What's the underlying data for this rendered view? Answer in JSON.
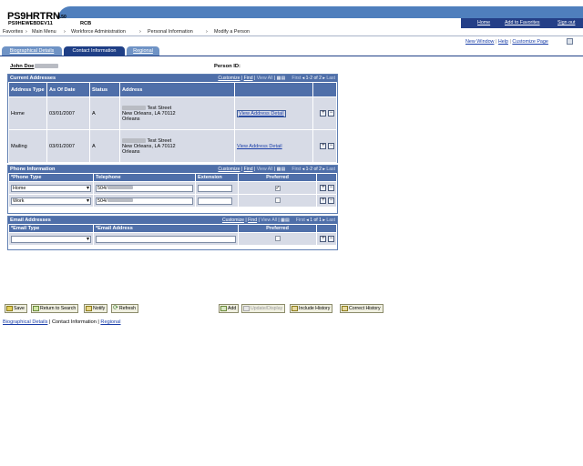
{
  "header": {
    "title": "PS9HRTRN",
    "version": "8.50",
    "subtitle": "PS9HEWEBDEV11",
    "rcb": "RCB",
    "links": [
      "Home",
      "Add to Favorites",
      "Sign out"
    ]
  },
  "breadcrumb": {
    "items": [
      "Favorites",
      "Main Menu",
      "Workforce Administration",
      "Personal Information",
      "Modify a Person"
    ]
  },
  "toplinks": {
    "new_window": "New Window",
    "help": "Help",
    "customize_page": "Customize Page"
  },
  "tabs": [
    {
      "label": "Biographical Details",
      "active": false
    },
    {
      "label": "Contact Information",
      "active": true
    },
    {
      "label": "Regional",
      "active": false
    }
  ],
  "person": {
    "name": "John Doe",
    "id_label": "Person ID:"
  },
  "grid_nav": {
    "customize": "Customize",
    "find": "Find",
    "view_all": "View All",
    "first": "First",
    "last": "Last"
  },
  "addresses": {
    "title": "Current Addresses",
    "range": "1-2 of 2",
    "headers": [
      "Address Type",
      "As Of Date",
      "Status",
      "Address"
    ],
    "detail_link": "View Address Detail",
    "rows": [
      {
        "type": "Home",
        "as_of": "03/01/2007",
        "status": "A",
        "line1": "Test Street",
        "line2": "New Orleans, LA 70112",
        "line3": "Orleans"
      },
      {
        "type": "Mailing",
        "as_of": "03/01/2007",
        "status": "A",
        "line1": "Test Street",
        "line2": "New Orleans, LA 70112",
        "line3": "Orleans"
      }
    ]
  },
  "phones": {
    "title": "Phone Information",
    "range": "1-2 of 2",
    "headers": [
      "*Phone Type",
      "Telephone",
      "Extension",
      "Preferred"
    ],
    "rows": [
      {
        "type": "Home",
        "telephone": "504/",
        "extension": "",
        "preferred": true
      },
      {
        "type": "Work",
        "telephone": "504/",
        "extension": "",
        "preferred": false
      }
    ]
  },
  "emails": {
    "title": "Email Addresses",
    "range": "1 of 1",
    "headers": [
      "*Email Type",
      "*Email Address",
      "Preferred"
    ],
    "rows": [
      {
        "type": "",
        "address": "",
        "preferred": false
      }
    ]
  },
  "buttons": {
    "save": "Save",
    "return": "Return to Search",
    "notify": "Notify",
    "refresh": "Refresh",
    "add": "Add",
    "update": "Update/Display",
    "include_history": "Include History",
    "correct_history": "Correct History"
  },
  "footer": {
    "links": [
      "Biographical Details",
      "Contact Information",
      "Regional"
    ]
  }
}
